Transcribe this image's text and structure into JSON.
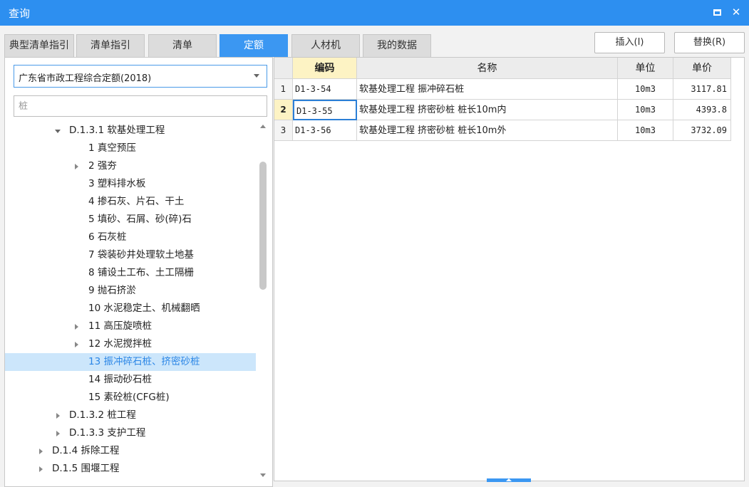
{
  "window": {
    "title": "查询",
    "maximize_icon": "maximize-icon",
    "close_label": "✕"
  },
  "tabs": [
    {
      "label": "典型清单指引",
      "active": false
    },
    {
      "label": "清单指引",
      "active": false
    },
    {
      "label": "清单",
      "active": false
    },
    {
      "label": "定额",
      "active": true
    },
    {
      "label": "人材机",
      "active": false
    },
    {
      "label": "我的数据",
      "active": false
    }
  ],
  "actions": {
    "insert_label": "插入(I)",
    "replace_label": "替换(R)"
  },
  "library_select": {
    "value": "广东省市政工程综合定额(2018)"
  },
  "search": {
    "value": "",
    "placeholder": "桩"
  },
  "tree": [
    {
      "label": "D.1.3.1 软基处理工程",
      "expanded": true
    },
    {
      "label": "1 真空预压"
    },
    {
      "label": "2 强夯",
      "expandable": true
    },
    {
      "label": "3 塑料排水板"
    },
    {
      "label": "4 掺石灰、片石、干土"
    },
    {
      "label": "5 填砂、石屑、砂(碎)石"
    },
    {
      "label": "6 石灰桩"
    },
    {
      "label": "7 袋装砂井处理软土地基"
    },
    {
      "label": "8 铺设土工布、土工隔栅"
    },
    {
      "label": "9 抛石挤淤"
    },
    {
      "label": "10 水泥稳定土、机械翻晒"
    },
    {
      "label": "11 高压旋喷桩",
      "expandable": true
    },
    {
      "label": "12 水泥搅拌桩",
      "expandable": true
    },
    {
      "label": "13 振冲碎石桩、挤密砂桩",
      "selected": true
    },
    {
      "label": "14 振动砂石桩"
    },
    {
      "label": "15 素砼桩(CFG桩)"
    },
    {
      "label": "D.1.3.2 桩工程",
      "expandable": true
    },
    {
      "label": "D.1.3.3 支护工程",
      "expandable": true
    },
    {
      "label": "D.1.4 拆除工程",
      "expandable": true
    },
    {
      "label": "D.1.5 围堰工程",
      "expandable": true
    }
  ],
  "table": {
    "headers": {
      "code": "编码",
      "name": "名称",
      "unit": "单位",
      "price": "单价"
    },
    "rows": [
      {
        "num": "1",
        "code": "D1-3-54",
        "name": "软基处理工程 振冲碎石桩",
        "unit": "10m3",
        "price": "3117.81"
      },
      {
        "num": "2",
        "code": "D1-3-55",
        "name": "软基处理工程 挤密砂桩 桩长10m内",
        "unit": "10m3",
        "price": "4393.8"
      },
      {
        "num": "3",
        "code": "D1-3-56",
        "name": "软基处理工程 挤密砂桩 桩长10m外",
        "unit": "10m3",
        "price": "3732.09"
      }
    ]
  }
}
